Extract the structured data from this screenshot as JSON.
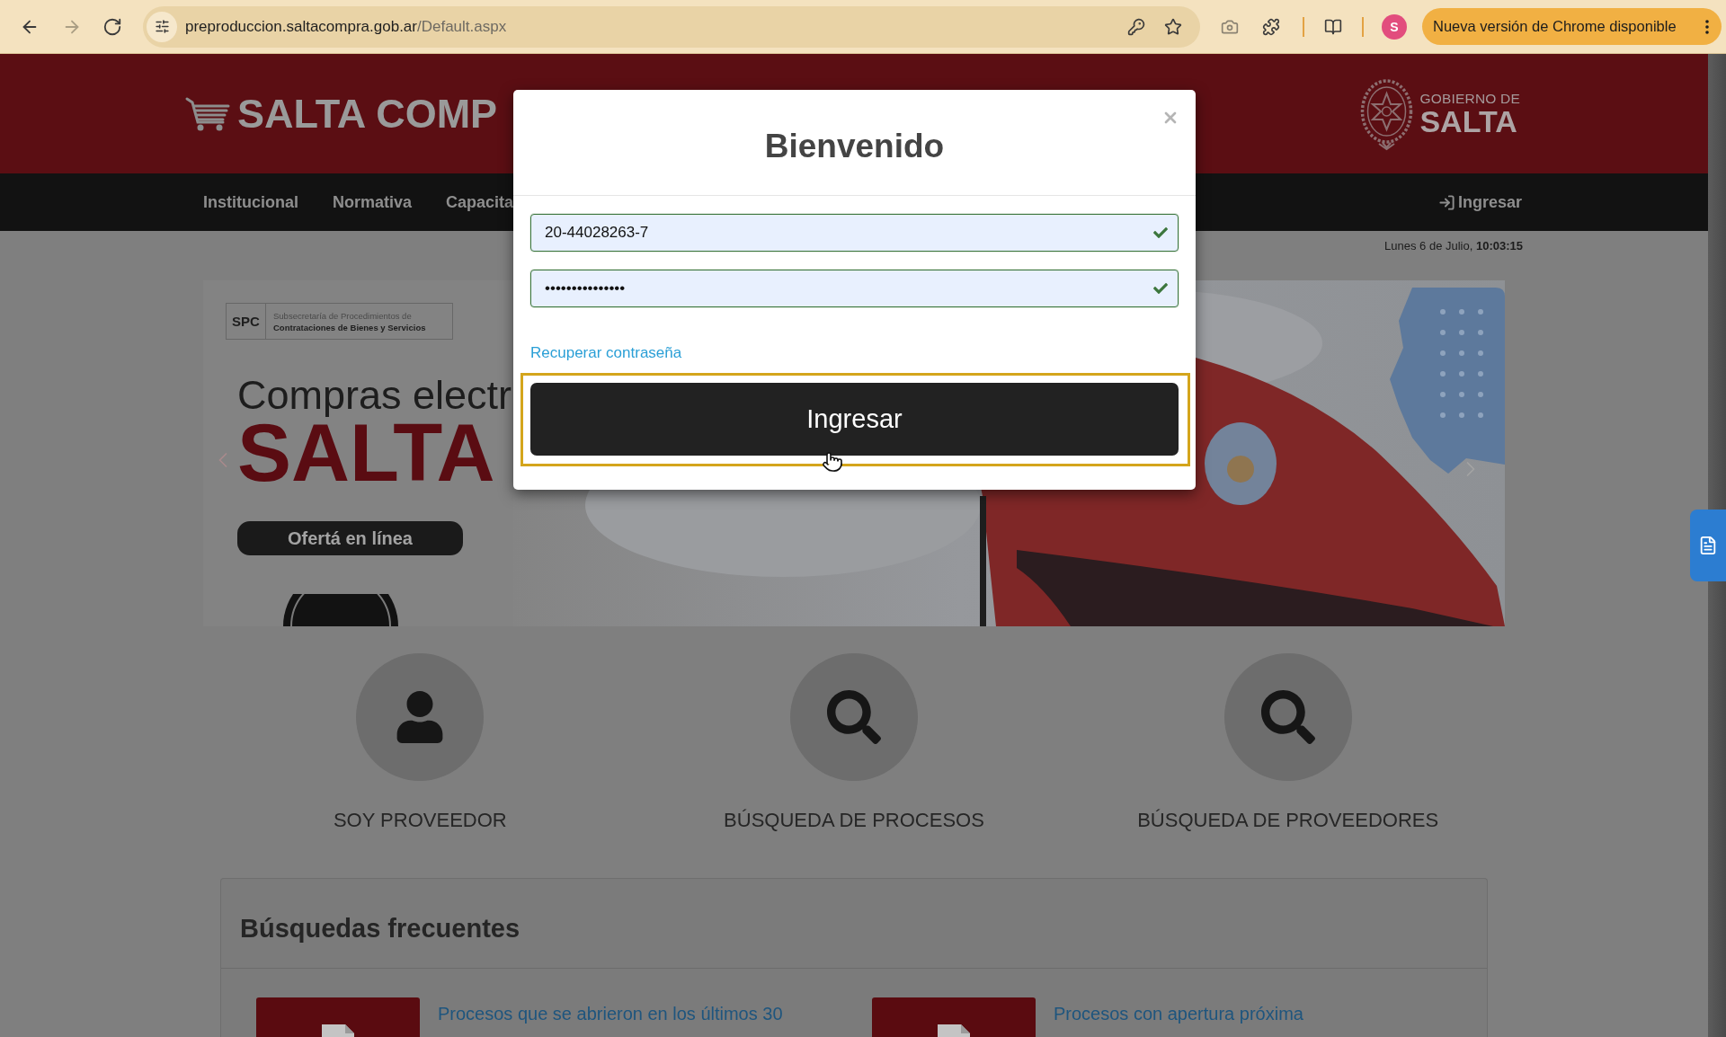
{
  "browser": {
    "nav_buttons": [
      {
        "kind": "back",
        "disabled": false
      },
      {
        "kind": "forward",
        "disabled": true
      },
      {
        "kind": "reload",
        "disabled": false
      }
    ],
    "url": {
      "host": "preproduccion.saltacompra.gob.ar",
      "path": "/Default.aspx"
    },
    "profile_initial": "S",
    "update_button": "Nueva versión de Chrome disponible"
  },
  "header": {
    "logo_text": "SALTA COMP",
    "gov_logo": {
      "line_1": "GOBIERNO DE",
      "line_2": "SALTA"
    }
  },
  "nav": {
    "items": [
      "Institucional",
      "Normativa",
      "Capacita"
    ],
    "login": "Ingresar"
  },
  "date": "Lunes 6 de Julio, **10:03:15**",
  "banner": {
    "badge": {
      "abbr": "SPC",
      "line_1": "Subsecretaría de Procedimientos de",
      "line_2": "Contrataciones de Bienes y Servicios"
    },
    "headline": "Compras electr",
    "title": "SALTA",
    "button": "Ofertá en línea"
  },
  "features": [
    {
      "kind": "user",
      "label": "SOY PROVEEDOR"
    },
    {
      "kind": "search",
      "label": "BÚSQUEDA DE PROCESOS"
    },
    {
      "kind": "search",
      "label": "BÚSQUEDA DE PROVEEDORES"
    }
  ],
  "frequent_searches": {
    "title": "Búsquedas frecuentes",
    "items": [
      "Procesos que se abrieron en los últimos 30",
      "Procesos con apertura próxima"
    ]
  },
  "modal": {
    "title": "Bienvenido",
    "fields": [
      {
        "value": "20-44028263-7",
        "valid": true
      },
      {
        "value": "•••••••••••••••",
        "valid": true
      }
    ],
    "link": "Recuperar contraseña",
    "submit": "Ingresar",
    "highlighted": true
  }
}
